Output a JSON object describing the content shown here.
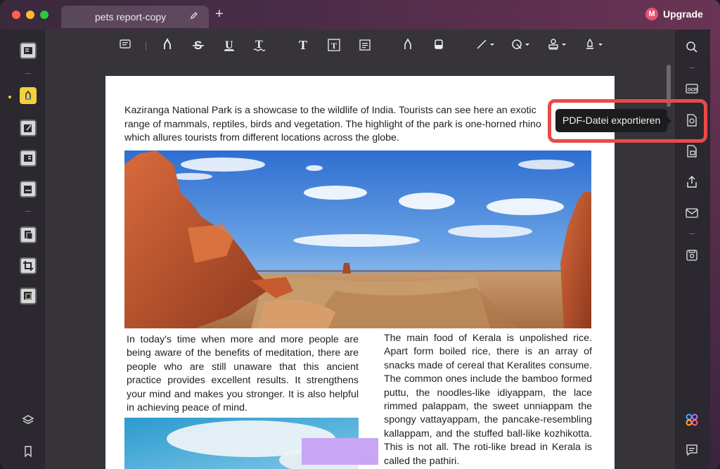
{
  "titlebar": {
    "tab_title": "pets report-copy",
    "upgrade_label": "Upgrade",
    "avatar_letter": "M"
  },
  "tooltip": {
    "text": "PDF-Datei exportieren"
  },
  "document": {
    "intro": "Kaziranga National Park is a showcase to the wildlife of India. Tourists can see here an exotic range of mammals, reptiles, birds and vegetation. The highlight of the park is one-horned rhino which allures tourists from different locations across the globe.",
    "left_column": "In today's time when more and more people are being aware of the benefits of meditation, there are people who are still unaware that this ancient practice provides excellent results. It strengthens your mind and makes you stronger. It is also helpful in achieving peace of mind.",
    "right_column": "The main food of Kerala is unpolished rice. Apart form boiled rice, there is an array of snacks made of cereal that Keralites consume. The common ones include the bamboo formed puttu, the noodles-like idiyappam, the lace rimmed palappam, the sweet unniappam the spongy vattayappam, the pancake-resembling kallappam, and the stuffed ball-like kozhikotta. This is not all. The roti-like bread in Kerala is called the pathiri."
  },
  "colors": {
    "accent_highlight": "#e94a4a",
    "active_tool": "#f3d03e",
    "upgrade_avatar": "#e8536d"
  },
  "icons": {
    "left_sidebar": [
      "reader-icon",
      "comment-icon",
      "edit-icon",
      "form-icon",
      "fill-sign-icon",
      "organize-pages-icon",
      "crop-icon",
      "watermark-icon",
      "layers-icon",
      "bookmark-icon"
    ],
    "toolbar": [
      "note-icon",
      "highlight-icon",
      "strikethrough-icon",
      "underline-icon",
      "squiggly-icon",
      "text-icon",
      "textbox-icon",
      "text-callout-icon",
      "pencil-icon",
      "eraser-icon",
      "line-icon",
      "shape-icon",
      "stamp-icon",
      "signature-icon"
    ],
    "right_sidebar": [
      "search-icon",
      "ocr-icon",
      "convert-icon",
      "protect-icon",
      "share-icon",
      "mail-icon",
      "save-icon",
      "ai-assistant-icon",
      "comments-panel-icon"
    ]
  }
}
